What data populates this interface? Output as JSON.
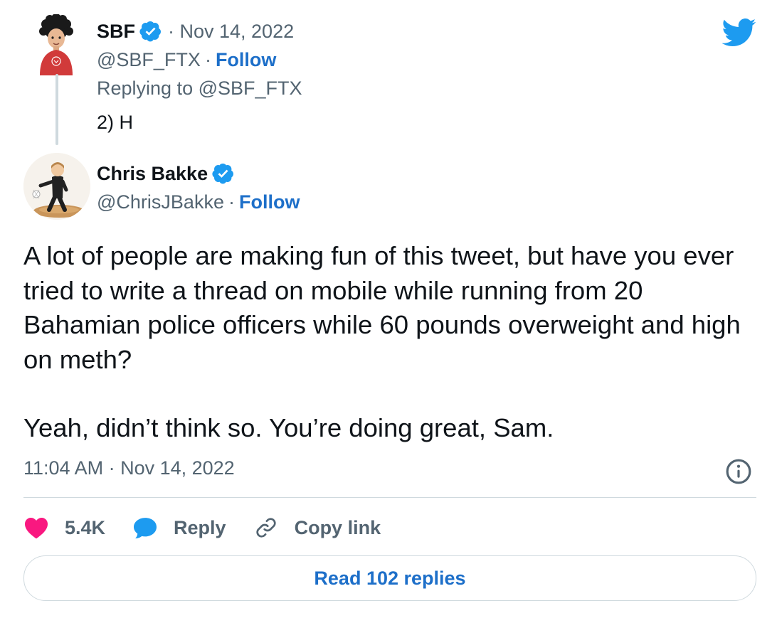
{
  "parent_tweet": {
    "author_name": "SBF",
    "date": "· Nov 14, 2022",
    "handle": "@SBF_FTX",
    "separator": "·",
    "follow_label": "Follow",
    "replying_to": "Replying to @SBF_FTX",
    "text": "2) H"
  },
  "main_tweet": {
    "author_name": "Chris Bakke",
    "handle": "@ChrisJBakke",
    "separator": "·",
    "follow_label": "Follow",
    "paragraph_1": "A lot of people are making fun of this tweet, but have you ever tried to write a thread on mobile while running from 20 Bahamian police officers while 60 pounds overweight and high on meth?",
    "paragraph_2": "Yeah, didn’t think so. You’re doing great, Sam.",
    "timestamp": "11:04 AM · Nov 14, 2022"
  },
  "actions": {
    "like_count": "5.4K",
    "reply_label": "Reply",
    "copy_link_label": "Copy link"
  },
  "read_replies_label": "Read 102 replies",
  "icons": {
    "brand": "twitter-bird-icon",
    "verified": "verified-badge-icon",
    "like": "heart-icon",
    "reply": "speech-bubble-icon",
    "copy": "link-icon",
    "info": "info-icon"
  },
  "colors": {
    "twitter_blue": "#1d9bf0",
    "link_blue": "#1d6fc9",
    "like_pink": "#f91880",
    "muted_text": "#536471",
    "divider": "#cfd9de"
  }
}
